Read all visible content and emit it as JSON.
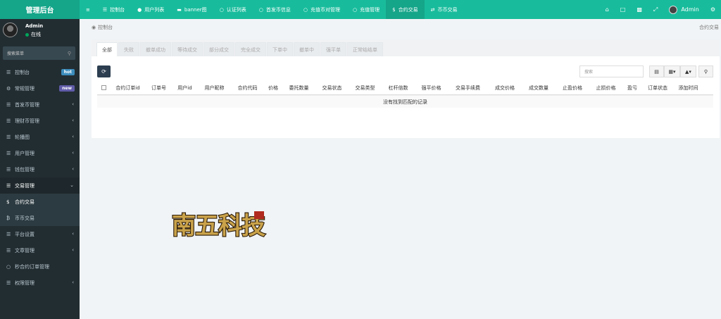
{
  "brand": "管理后台",
  "topnav": {
    "menu_toggle_icon": "≡",
    "items": [
      {
        "icon": "list-icon",
        "glyph": "☰",
        "label": "控制台",
        "active": false
      },
      {
        "icon": "user-icon",
        "glyph": "👤",
        "label": "用户列表",
        "active": false
      },
      {
        "icon": "image-icon",
        "glyph": "▬",
        "label": "banner图",
        "active": false
      },
      {
        "icon": "circle-icon",
        "glyph": "○",
        "label": "认证列表",
        "active": false
      },
      {
        "icon": "circle-icon",
        "glyph": "○",
        "label": "首发币信息",
        "active": false
      },
      {
        "icon": "circle-icon",
        "glyph": "○",
        "label": "充值币对管理",
        "active": false
      },
      {
        "icon": "circle-icon",
        "glyph": "○",
        "label": "充值管理",
        "active": false
      },
      {
        "icon": "dollar-icon",
        "glyph": "$",
        "label": "合约交易",
        "active": true
      },
      {
        "icon": "exchange-icon",
        "glyph": "⇄",
        "label": "币币交易",
        "active": false
      }
    ],
    "right_user": "Admin"
  },
  "sidebar": {
    "user_name": "Admin",
    "user_status": "在线",
    "search_placeholder": "搜索菜单",
    "items": [
      {
        "label": "控制台",
        "badge": "hot",
        "badge_color": "#3c8dbc"
      },
      {
        "label": "常规管理",
        "badge": "new",
        "badge_color": "#605ca8"
      },
      {
        "label": "首发币管理"
      },
      {
        "label": "理财币管理"
      },
      {
        "label": "轮播图"
      },
      {
        "label": "用户管理"
      },
      {
        "label": "钱包管理"
      },
      {
        "label": "交易管理"
      },
      {
        "label": "合约交易"
      },
      {
        "label": "币币交易"
      },
      {
        "label": "平台设置"
      },
      {
        "label": "文章管理"
      },
      {
        "label": "秒合约订单管理"
      },
      {
        "label": "权限管理"
      }
    ]
  },
  "breadcrumb": {
    "home": "控制台",
    "current": "合约交易"
  },
  "tabs": [
    "全部",
    "失败",
    "撤单成功",
    "等待成交",
    "部分成交",
    "完全成交",
    "下单中",
    "撤单中",
    "强平单",
    "正常结结单"
  ],
  "table": {
    "search_placeholder": "搜索",
    "columns": [
      "合约订单id",
      "订单号",
      "用户id",
      "用户昵称",
      "合约代码",
      "价格",
      "委托数量",
      "交易状态",
      "交易类型",
      "杠杆倍数",
      "强平价格",
      "交易手续费",
      "成交价格",
      "成交数量",
      "止盈价格",
      "止损价格",
      "盈亏",
      "订单状态",
      "添加时间"
    ],
    "empty_text": "没有找到匹配的记录"
  },
  "logo_text": "南五科技",
  "colors": {
    "accent": "#18bc9c",
    "accent_dark": "#15a589",
    "sidebar": "#222d32",
    "refresh": "#2c3e50"
  }
}
